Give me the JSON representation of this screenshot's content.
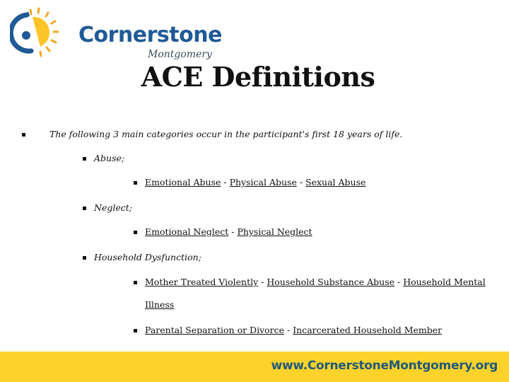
{
  "logo": {
    "name": "Cornerstone",
    "subtitle": "Montgomery",
    "colors": {
      "blue": "#1f5a96",
      "yellow": "#fdc42a",
      "orange": "#f5a623"
    }
  },
  "title": "ACE Definitions",
  "intro": "The following 3 main categories occur in the participant's first 18 years of life.",
  "categories": [
    {
      "label": "Abuse;",
      "lines": [
        {
          "items": [
            "Emotional Abuse",
            "Physical Abuse",
            "Sexual Abuse"
          ]
        }
      ]
    },
    {
      "label": "Neglect;",
      "lines": [
        {
          "items": [
            "Emotional Neglect",
            "Physical Neglect"
          ]
        }
      ]
    },
    {
      "label": "Household Dysfunction;",
      "lines": [
        {
          "items": [
            "Mother Treated Violently",
            "Household Substance Abuse",
            "Household Mental"
          ],
          "continuation": "Illness"
        },
        {
          "items": [
            "Parental Separation or Divorce",
            "Incarcerated Household Member"
          ]
        }
      ]
    }
  ],
  "separator": " - ",
  "footer": {
    "url": "www.CornerstoneMontgomery.org",
    "background": "#fdd22a",
    "text_color": "#1f5a7a"
  }
}
